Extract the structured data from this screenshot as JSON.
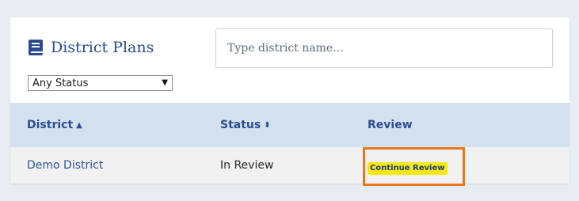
{
  "header": {
    "title": "District Plans",
    "search": {
      "placeholder": "Type district name...",
      "value": ""
    },
    "status_filter": {
      "selected": "Any Status"
    }
  },
  "table": {
    "columns": [
      {
        "label": "District",
        "sort": "ascending"
      },
      {
        "label": "Status",
        "sort": "sortable"
      },
      {
        "label": "Review"
      }
    ],
    "rows": [
      {
        "district": "Demo District",
        "status": "In Review",
        "review_action": "Continue Review"
      }
    ]
  },
  "icons": {
    "title_icon": "book-icon",
    "select_caret": "caret-down-icon",
    "sort_ascending": "sort-ascending-icon",
    "sort_both": "sort-both-icon"
  },
  "colors": {
    "accent": "#2a4c8f",
    "table_header_bg": "#d3e0ef",
    "continue_button_bg": "#f5e81a",
    "highlight_border": "#e8771f"
  }
}
